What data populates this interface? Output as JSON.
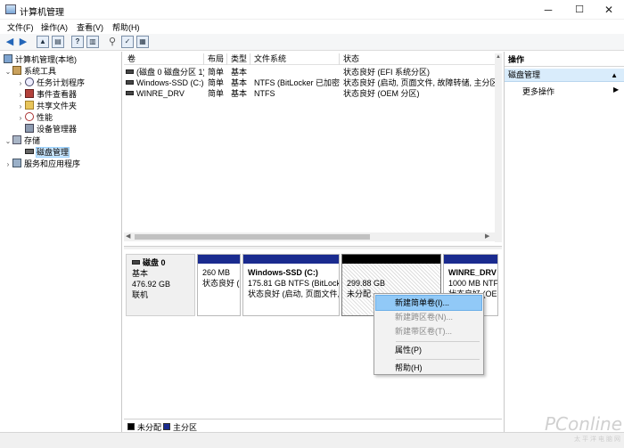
{
  "window": {
    "title": "计算机管理",
    "controls": {
      "minimize": "─",
      "maximize": "☐",
      "close": "✕"
    }
  },
  "menubar": [
    "文件(F)",
    "操作(A)",
    "查看(V)",
    "帮助(H)"
  ],
  "toolbar": {
    "back_icon": "arrow-left",
    "forward_icon": "arrow-right",
    "help_glyph": "?"
  },
  "tree": {
    "items": [
      {
        "label": "计算机管理(本地)",
        "expander": "",
        "icon": "computer-icon"
      },
      {
        "label": "系统工具",
        "expander": "⌄",
        "icon": "tools-icon"
      },
      {
        "label": "任务计划程序",
        "expander": "›",
        "icon": "clock-icon"
      },
      {
        "label": "事件查看器",
        "expander": "›",
        "icon": "event-viewer-icon"
      },
      {
        "label": "共享文件夹",
        "expander": "›",
        "icon": "folder-icon"
      },
      {
        "label": "性能",
        "expander": "›",
        "icon": "performance-icon"
      },
      {
        "label": "设备管理器",
        "expander": "",
        "icon": "device-manager-icon"
      },
      {
        "label": "存储",
        "expander": "⌄",
        "icon": "storage-icon"
      },
      {
        "label": "磁盘管理",
        "expander": "",
        "icon": "disk-icon"
      },
      {
        "label": "服务和应用程序",
        "expander": "›",
        "icon": "services-icon"
      }
    ]
  },
  "volume_list": {
    "columns": [
      "卷",
      "布局",
      "类型",
      "文件系统",
      "状态"
    ],
    "rows": [
      {
        "volume": "(磁盘 0 磁盘分区 1)",
        "layout": "简单",
        "type": "基本",
        "fs": "",
        "status": "状态良好 (EFI 系统分区)"
      },
      {
        "volume": "Windows-SSD (C:)",
        "layout": "简单",
        "type": "基本",
        "fs": "NTFS (BitLocker 已加密)",
        "status": "状态良好 (启动, 页面文件, 故障转储, 主分区)"
      },
      {
        "volume": "WINRE_DRV",
        "layout": "简单",
        "type": "基本",
        "fs": "NTFS",
        "status": "状态良好 (OEM 分区)"
      }
    ]
  },
  "disk": {
    "name": "磁盘 0",
    "type": "基本",
    "size": "476.92 GB",
    "status": "联机",
    "partitions": [
      {
        "name": "",
        "line1": "260 MB",
        "line2": "状态良好 (",
        "bar": "#1a2b8f"
      },
      {
        "name": "Windows-SSD  (C:)",
        "line1": "175.81 GB NTFS (BitLocke",
        "line2": "状态良好 (启动, 页面文件,",
        "bar": "#1a2b8f"
      },
      {
        "name": "",
        "line1": "299.88 GB",
        "line2": "未分配",
        "bar": "#000000"
      },
      {
        "name": "WINRE_DRV",
        "line1": "1000 MB NTF",
        "line2": "状态良好 (OE",
        "bar": "#1a2b8f"
      }
    ]
  },
  "legend": [
    {
      "label": "未分配",
      "color": "#000000"
    },
    {
      "label": "主分区",
      "color": "#1a2b8f"
    }
  ],
  "actions": {
    "header": "操作",
    "section": "磁盘管理",
    "section_caret": "▲",
    "more": "更多操作",
    "more_arrow": "▶"
  },
  "context_menu": {
    "items": [
      {
        "label": "新建简单卷(I)...",
        "state": "highlighted"
      },
      {
        "label": "新建跨区卷(N)...",
        "state": "disabled"
      },
      {
        "label": "新建带区卷(T)...",
        "state": "disabled"
      },
      {
        "label": "属性(P)",
        "state": "normal"
      },
      {
        "label": "帮助(H)",
        "state": "normal"
      }
    ]
  },
  "watermark": {
    "brand": "PConline",
    "sub": "太平洋电脑网"
  },
  "colors": {
    "primary_partition": "#1a2b8f",
    "unallocated": "#000000",
    "selection": "#cce8ff",
    "menu_highlight": "#91c9f7"
  }
}
